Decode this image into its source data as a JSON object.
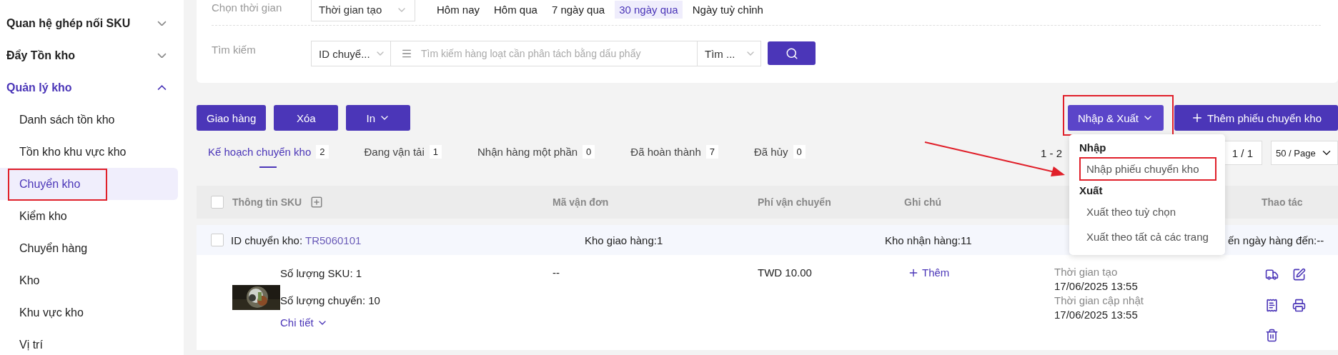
{
  "sidebar": {
    "groups": [
      {
        "label": "Quan hệ ghép nối SKU",
        "expanded": false,
        "active": false
      },
      {
        "label": "Đẩy Tồn kho",
        "expanded": false,
        "active": false
      },
      {
        "label": "Quản lý kho",
        "expanded": true,
        "active": true,
        "children": [
          {
            "label": "Danh sách tồn kho",
            "selected": false,
            "annotated": false
          },
          {
            "label": "Tồn kho khu vực kho",
            "selected": false,
            "annotated": false
          },
          {
            "label": "Chuyển kho",
            "selected": true,
            "annotated": true
          },
          {
            "label": "Kiểm kho",
            "selected": false,
            "annotated": false
          },
          {
            "label": "Chuyển hàng",
            "selected": false,
            "annotated": false
          },
          {
            "label": "Kho",
            "selected": false,
            "annotated": false
          },
          {
            "label": "Khu vực kho",
            "selected": false,
            "annotated": false
          },
          {
            "label": "Vị trí",
            "selected": false,
            "annotated": false
          }
        ]
      }
    ]
  },
  "filters": {
    "time": {
      "label": "Chọn thời gian",
      "field": "Thời gian tạo",
      "quick": [
        {
          "label": "Hôm nay",
          "selected": false
        },
        {
          "label": "Hôm qua",
          "selected": false
        },
        {
          "label": "7 ngày qua",
          "selected": false
        },
        {
          "label": "30 ngày qua",
          "selected": true
        },
        {
          "label": "Ngày tuỳ chỉnh",
          "selected": false
        }
      ]
    },
    "search": {
      "label": "Tìm kiếm",
      "type_field": "ID chuyể...",
      "placeholder": "Tìm kiếm hàng loạt cần phân tách bằng dấu phẩy",
      "mode_field": "Tìm ..."
    }
  },
  "actions": {
    "left": [
      {
        "label": "Giao hàng",
        "kind": "plain"
      },
      {
        "label": "Xóa",
        "kind": "plain"
      },
      {
        "label": "In",
        "kind": "dropdown"
      }
    ],
    "right": [
      {
        "label": "Nhập & Xuất",
        "kind": "dropdown",
        "annotated": true
      },
      {
        "label": "Thêm phiếu chuyển kho",
        "kind": "add"
      }
    ]
  },
  "menu": {
    "sections": [
      {
        "title": "Nhập",
        "items": [
          {
            "label": "Nhập phiếu chuyển kho",
            "annotated": true
          }
        ]
      },
      {
        "title": "Xuất",
        "items": [
          {
            "label": "Xuất theo tuỳ chọn",
            "annotated": false
          },
          {
            "label": "Xuất theo tất cả các trang",
            "annotated": false
          }
        ]
      }
    ]
  },
  "tabs": [
    {
      "label": "Kế hoạch chuyển kho",
      "count": "2",
      "selected": true
    },
    {
      "label": "Đang vận tải",
      "count": "1",
      "selected": false
    },
    {
      "label": "Nhận hàng một phần",
      "count": "0",
      "selected": false
    },
    {
      "label": "Đã hoàn thành",
      "count": "7",
      "selected": false
    },
    {
      "label": "Đã hủy",
      "count": "0",
      "selected": false
    }
  ],
  "pagination": {
    "range": "1 - 2",
    "page": "1 / 1",
    "page_size": "50 / Page"
  },
  "table": {
    "all_checked": false,
    "columns": [
      "Thông tin SKU",
      "Mã vận đơn",
      "Phí vận chuyển",
      "Ghi chú",
      "Thao tác"
    ],
    "group": {
      "checked": false,
      "id_label": "ID chuyển kho:",
      "id": "TR5060101",
      "from": "Kho giao hàng:1",
      "to": "Kho nhận hàng:11",
      "eta": "ến ngày hàng đến:--"
    },
    "item": {
      "sku_count": "Số lượng SKU: 1",
      "qty": "Số lượng chuyển: 10",
      "detail": "Chi tiết",
      "tracking": "--",
      "fee": "TWD 10.00",
      "note_action": "Thêm",
      "times": [
        {
          "label": "Thời gian tạo",
          "value": "17/06/2025 13:55"
        },
        {
          "label": "Thời gian cập nhật",
          "value": "17/06/2025 13:55"
        }
      ]
    }
  }
}
